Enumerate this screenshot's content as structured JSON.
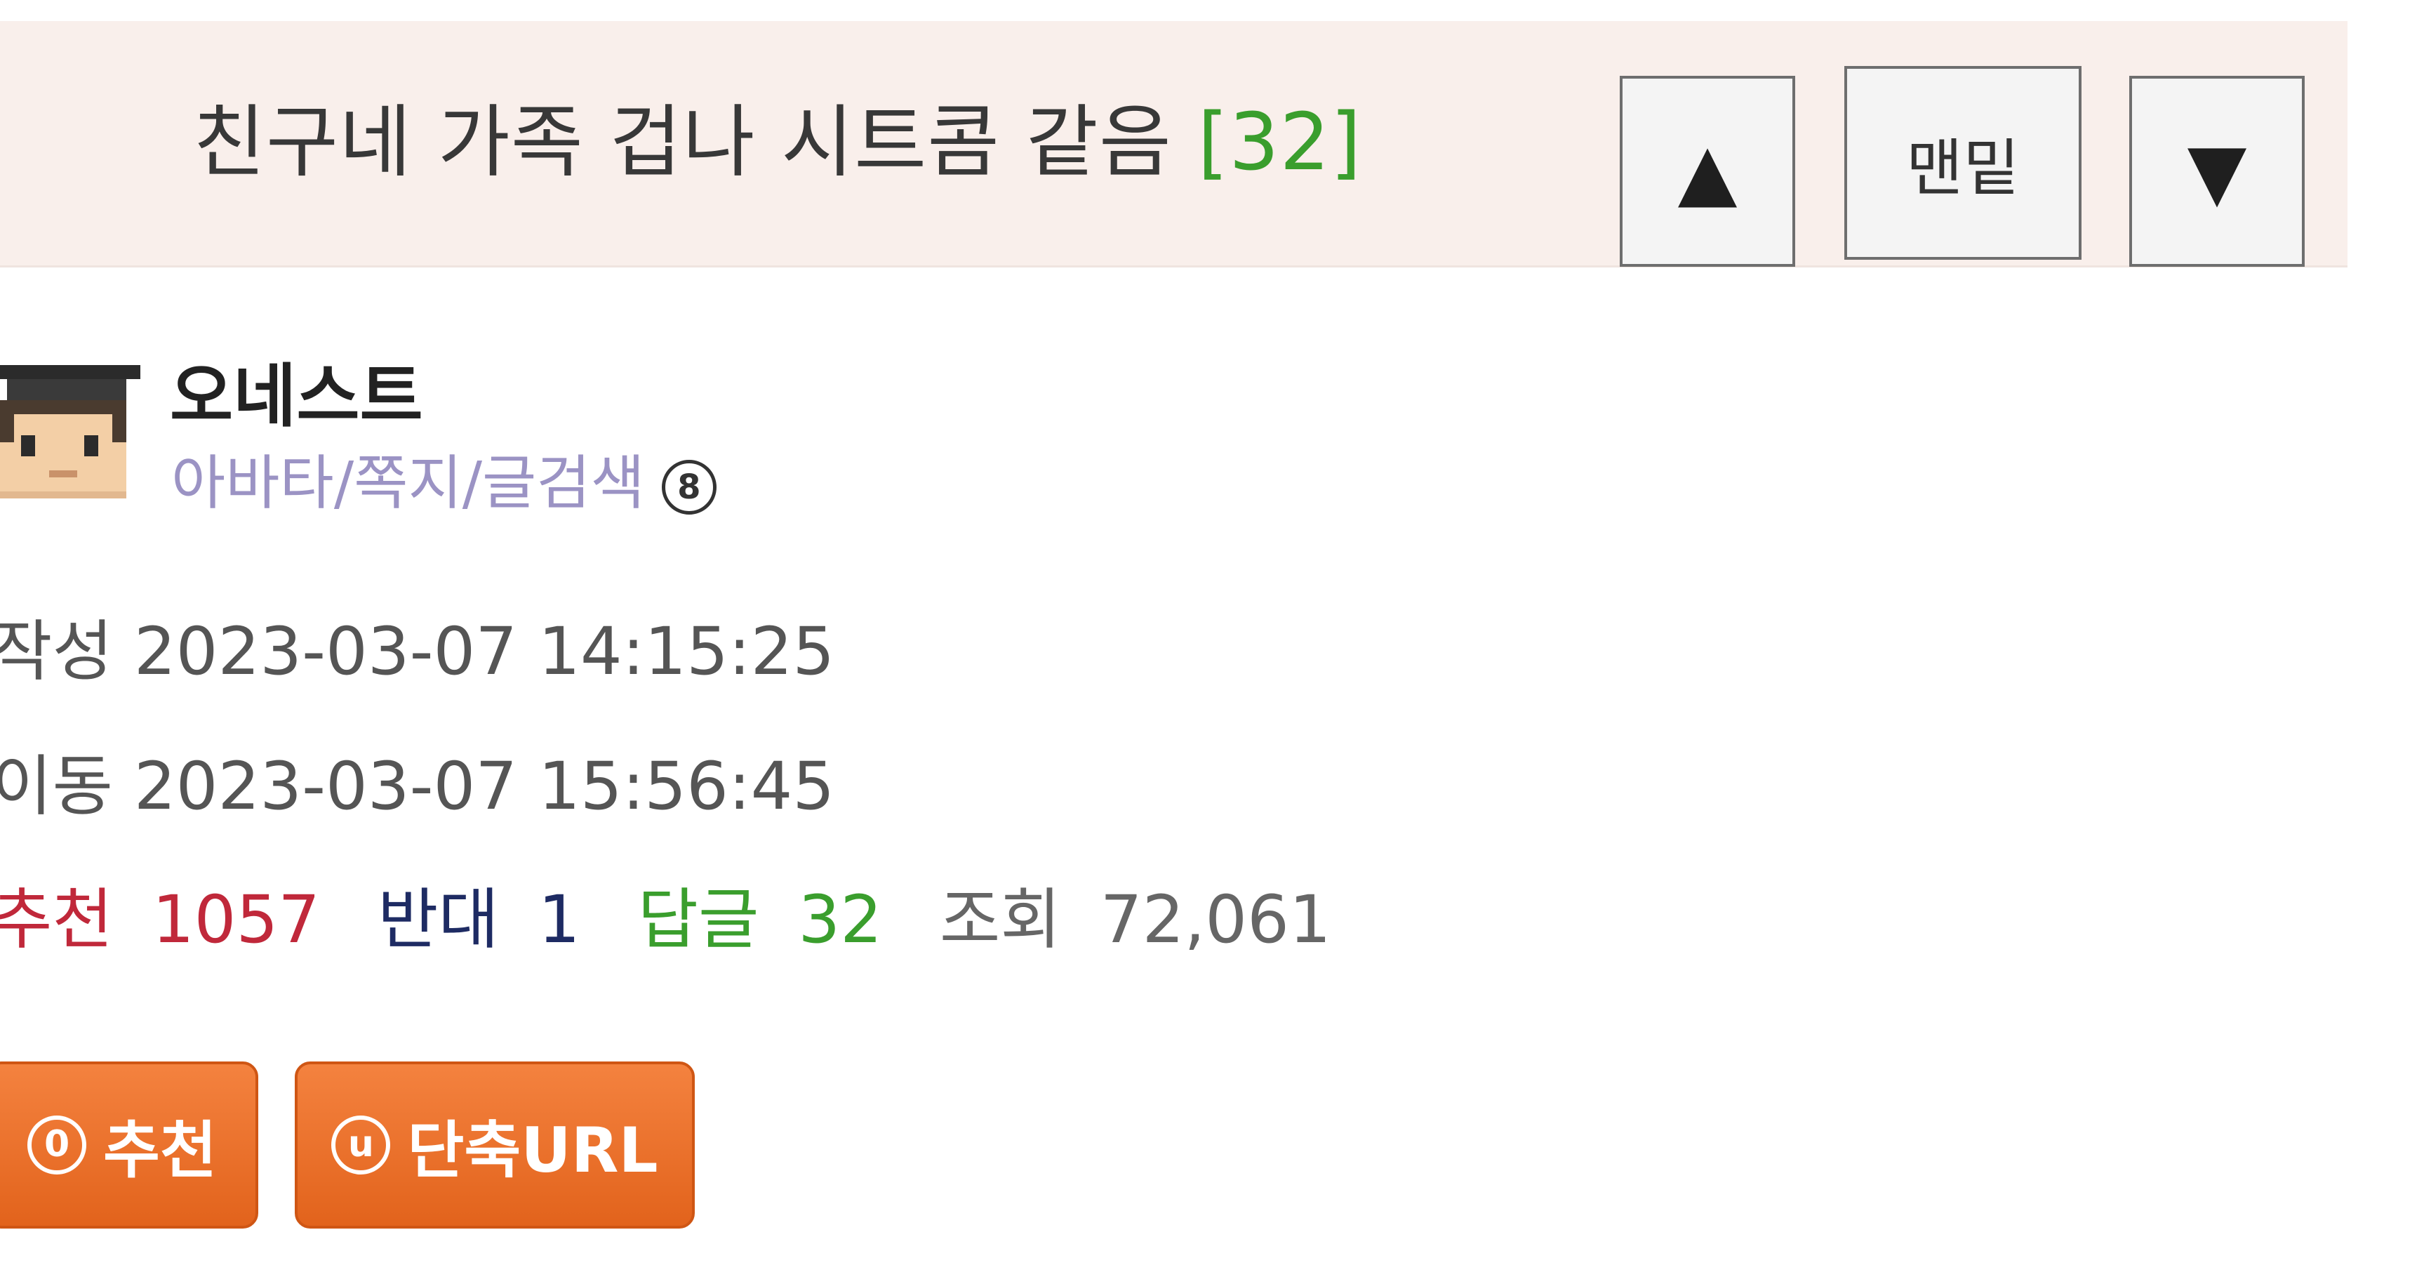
{
  "post": {
    "title": "친구네 가족 겁나 시트콤 같음",
    "reply_count_label": "[32]"
  },
  "nav": {
    "up_icon": "triangle-up-icon",
    "bottom_label": "맨밑",
    "down_icon": "triangle-down-icon"
  },
  "author": {
    "name": "오네스트",
    "links": "아바타/쪽지/글검색",
    "badge": "8",
    "avatar_icon": "pixel-avatar-graduate-icon"
  },
  "meta": {
    "written_label": "작성",
    "written_value": "2023-03-07 14:15:25",
    "moved_label": "이동",
    "moved_value": "2023-03-07 15:56:45"
  },
  "stats": {
    "recommend_label": "추천",
    "recommend_value": "1057",
    "oppose_label": "반대",
    "oppose_value": "1",
    "reply_label": "답글",
    "reply_value": "32",
    "views_label": "조회",
    "views_value": "72,061"
  },
  "actions": {
    "recommend_icon_glyph": "0",
    "recommend_label": "추천",
    "shorturl_icon_glyph": "u",
    "shorturl_label": "단축URL"
  },
  "colors": {
    "title_bar_bg": "#f9efeb",
    "reply_count": "#3a9e2d",
    "recommend": "#c0283a",
    "oppose": "#1e2b63",
    "author_links": "#9b93c4",
    "button_orange": "#ea6c24"
  }
}
